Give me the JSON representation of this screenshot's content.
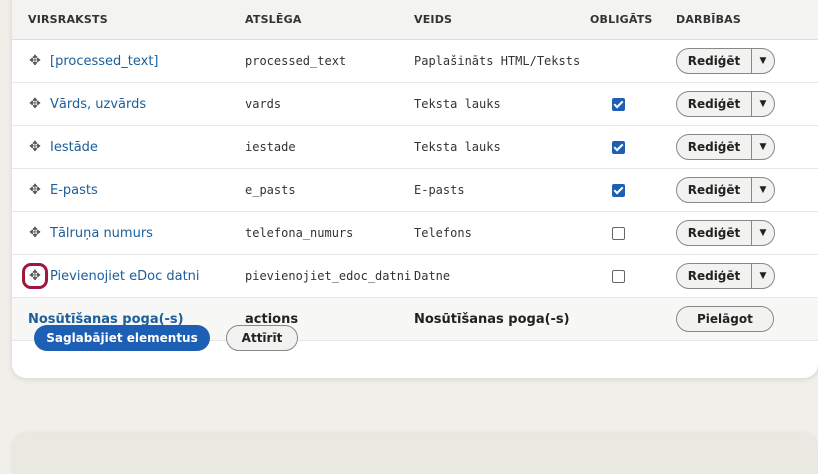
{
  "table": {
    "headers": {
      "title": "VIRSRAKSTS",
      "key": "ATSLĒGA",
      "type": "VEIDS",
      "required": "OBLIGĀTS",
      "operations": "DARBĪBAS"
    },
    "rows": [
      {
        "title": "[processed_text]",
        "key": "processed_text",
        "type": "Paplašināts HTML/Teksts",
        "required": null
      },
      {
        "title": "Vārds, uzvārds",
        "key": "vards",
        "type": "Teksta lauks",
        "required": true
      },
      {
        "title": "Iestāde",
        "key": "iestade",
        "type": "Teksta lauks",
        "required": true
      },
      {
        "title": "E-pasts",
        "key": "e_pasts",
        "type": "E-pasts",
        "required": true
      },
      {
        "title": "Tālruņa numurs",
        "key": "telefona_numurs",
        "type": "Telefons",
        "required": false
      },
      {
        "title": "Pievienojiet eDoc datni",
        "key": "pievienojiet_edoc_datni",
        "type": "Datne",
        "required": false
      }
    ],
    "edit_label": "Rediģēt",
    "actions_row": {
      "title": "Nosūtīšanas poga(-s)",
      "key": "actions",
      "type": "Nosūtīšanas poga(-s)",
      "customize_label": "Pielāgot"
    }
  },
  "form": {
    "save_label": "Saglabājiet elementus",
    "reset_label": "Attīrīt"
  },
  "colors": {
    "primary": "#1d5fb4",
    "link": "#1a5e9b",
    "focus_ring": "#a0173d"
  },
  "icons": {
    "drag_handle": "move-arrows-icon",
    "dropdown": "chevron-down-icon"
  }
}
